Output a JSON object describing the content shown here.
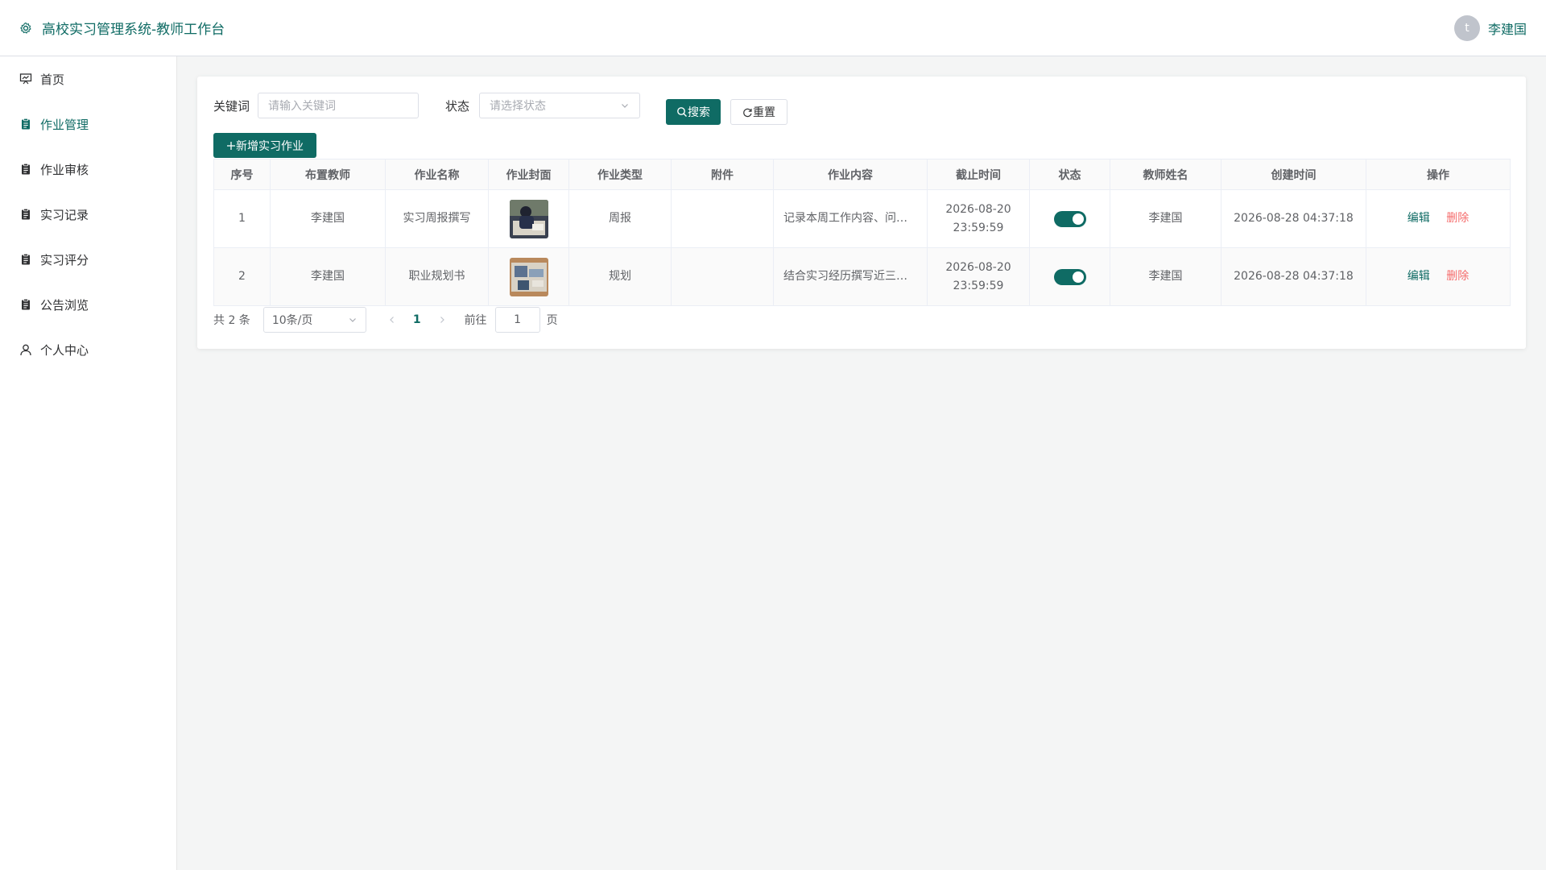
{
  "header": {
    "title": "高校实习管理系统-教师工作台",
    "avatar_letter": "t",
    "username": "李建国"
  },
  "sidebar": {
    "items": [
      {
        "label": "首页",
        "icon": "presentation-icon"
      },
      {
        "label": "作业管理",
        "icon": "clipboard-icon",
        "active": true
      },
      {
        "label": "作业审核",
        "icon": "clipboard-icon"
      },
      {
        "label": "实习记录",
        "icon": "clipboard-icon"
      },
      {
        "label": "实习评分",
        "icon": "clipboard-icon"
      },
      {
        "label": "公告浏览",
        "icon": "clipboard-icon"
      },
      {
        "label": "个人中心",
        "icon": "user-icon"
      }
    ]
  },
  "search": {
    "keyword_label": "关键词",
    "keyword_placeholder": "请输入关键词",
    "status_label": "状态",
    "status_placeholder": "请选择状态",
    "search_button": "搜索",
    "reset_button": "重置",
    "add_button": "新增实习作业"
  },
  "table": {
    "headers": [
      "序号",
      "布置教师",
      "作业名称",
      "作业封面",
      "作业类型",
      "附件",
      "作业内容",
      "截止时间",
      "状态",
      "教师姓名",
      "创建时间",
      "操作"
    ],
    "rows": [
      {
        "index": "1",
        "teacher": "李建国",
        "name": "实习周报撰写",
        "type": "周报",
        "attachment": "",
        "content": "记录本周工作内容、问…",
        "deadline_date": "2026-08-20",
        "deadline_time": "23:59:59",
        "status_on": true,
        "teacher_name": "李建国",
        "created": "2026-08-28 04:37:18",
        "edit": "编辑",
        "delete": "删除"
      },
      {
        "index": "2",
        "teacher": "李建国",
        "name": "职业规划书",
        "type": "规划",
        "attachment": "",
        "content": "结合实习经历撰写近三…",
        "deadline_date": "2026-08-20",
        "deadline_time": "23:59:59",
        "status_on": true,
        "teacher_name": "李建国",
        "created": "2026-08-28 04:37:18",
        "edit": "编辑",
        "delete": "删除"
      }
    ]
  },
  "pagination": {
    "total": "共 2 条",
    "page_size": "10条/页",
    "current_page": "1",
    "goto_label": "前往",
    "goto_value": "1",
    "page_suffix": "页"
  },
  "colors": {
    "primary": "#0f6b64",
    "danger": "#f56c6c"
  }
}
